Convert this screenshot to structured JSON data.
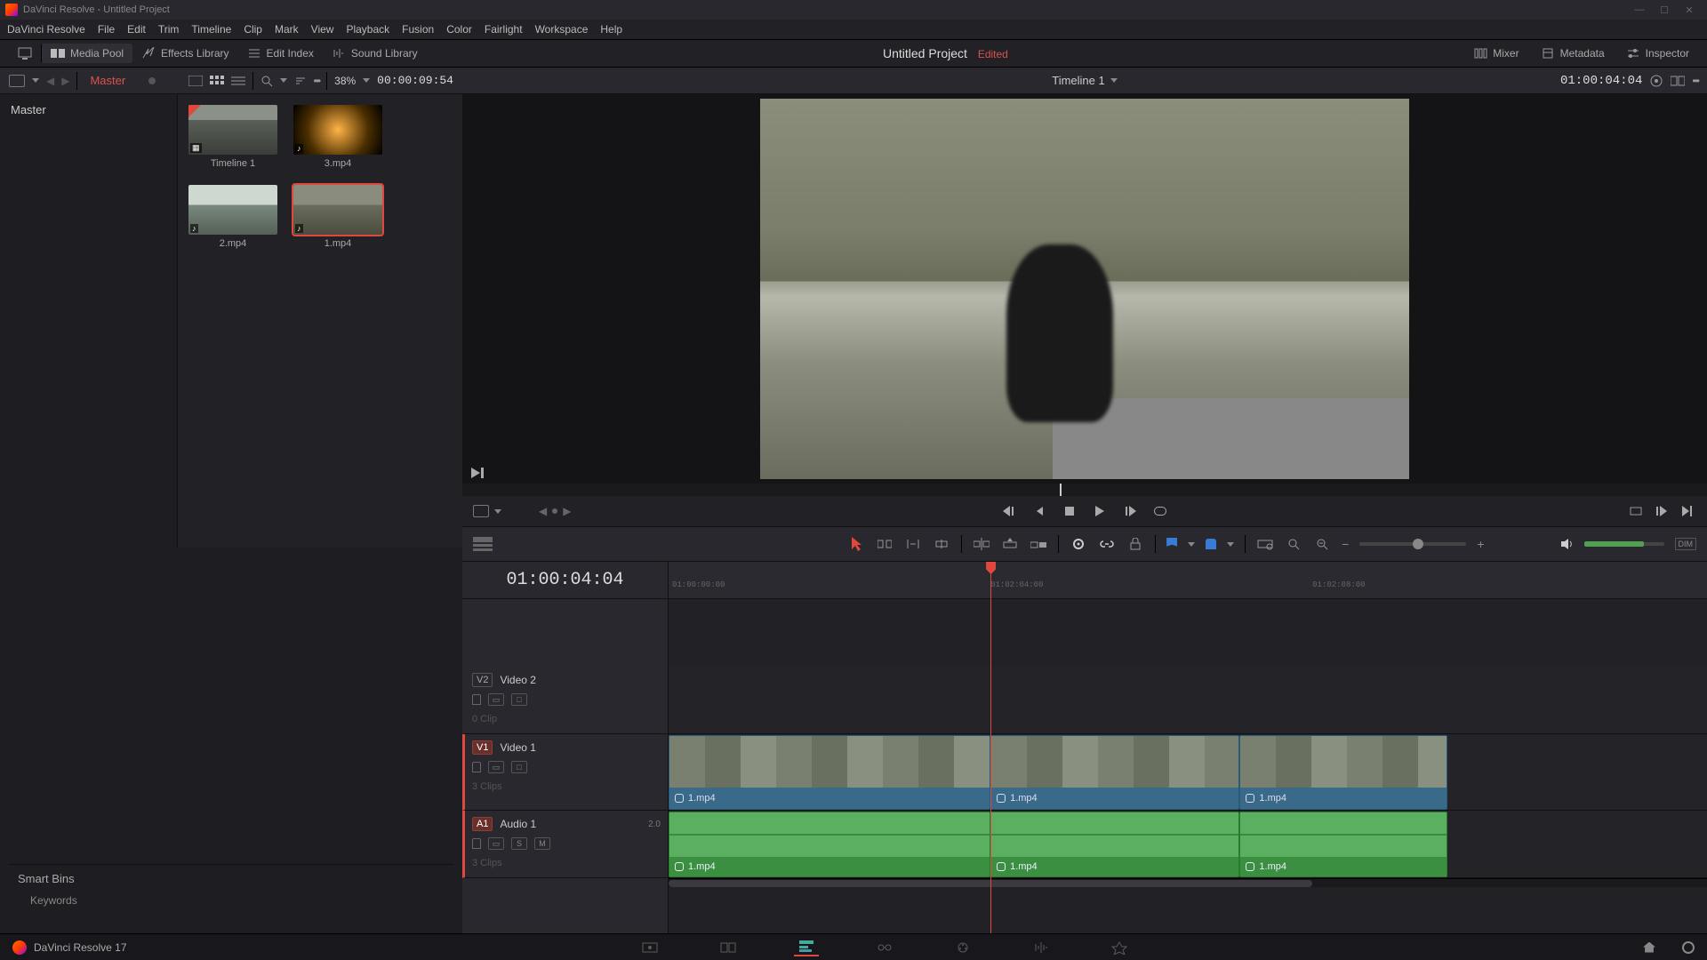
{
  "titlebar": {
    "text": "DaVinci Resolve - Untitled Project"
  },
  "menu": [
    "DaVinci Resolve",
    "File",
    "Edit",
    "Trim",
    "Timeline",
    "Clip",
    "Mark",
    "View",
    "Playback",
    "Fusion",
    "Color",
    "Fairlight",
    "Workspace",
    "Help"
  ],
  "panels": {
    "left": [
      {
        "id": "media-pool",
        "label": "Media Pool",
        "active": true
      },
      {
        "id": "effects-library",
        "label": "Effects Library"
      },
      {
        "id": "edit-index",
        "label": "Edit Index"
      },
      {
        "id": "sound-library",
        "label": "Sound Library"
      }
    ],
    "project": "Untitled Project",
    "status": "Edited",
    "right": [
      {
        "id": "mixer",
        "label": "Mixer"
      },
      {
        "id": "metadata",
        "label": "Metadata"
      },
      {
        "id": "inspector",
        "label": "Inspector"
      }
    ]
  },
  "pool": {
    "master": "Master",
    "zoom": "38%",
    "src_tc": "00:00:09:54",
    "timeline_name": "Timeline 1",
    "rec_tc": "01:00:04:04",
    "bin_root": "Master",
    "clips": [
      {
        "name": "Timeline 1",
        "thumb": "g-road",
        "is_timeline": true,
        "selected": false
      },
      {
        "name": "3.mp4",
        "thumb": "g-tunnel",
        "is_timeline": false,
        "selected": false
      },
      {
        "name": "2.mp4",
        "thumb": "g-lake",
        "is_timeline": false,
        "selected": false
      },
      {
        "name": "1.mp4",
        "thumb": "g-moto",
        "is_timeline": false,
        "selected": true
      }
    ],
    "smart_bins_title": "Smart Bins",
    "smart_bins": [
      "Keywords"
    ]
  },
  "timeline": {
    "tc": "01:00:04:04",
    "ruler": [
      "01:00:00:00",
      "01:02:04:00",
      "01:02:08:00"
    ],
    "playhead_pct": 31,
    "tracks": {
      "v2": {
        "id": "V2",
        "name": "Video 2",
        "clips_label": "0 Clip",
        "enabled": false
      },
      "v1": {
        "id": "V1",
        "name": "Video 1",
        "clips_label": "3 Clips",
        "enabled": true
      },
      "a1": {
        "id": "A1",
        "name": "Audio 1",
        "clips_label": "3 Clips",
        "enabled": true,
        "ch": "2.0",
        "solo": "S",
        "mute": "M"
      }
    },
    "video_clips": [
      {
        "name": "1.mp4",
        "width_pct": 31
      },
      {
        "name": "1.mp4",
        "width_pct": 24
      },
      {
        "name": "1.mp4",
        "width_pct": 20
      }
    ],
    "audio_clips": [
      {
        "name": "1.mp4",
        "width_pct": 31
      },
      {
        "name": "1.mp4",
        "width_pct": 24
      },
      {
        "name": "1.mp4",
        "width_pct": 20
      }
    ]
  },
  "toolbar": {
    "dim": "DIM"
  },
  "footer": {
    "app": "DaVinci Resolve 17"
  },
  "pages": [
    "media",
    "cut",
    "edit",
    "fusion",
    "color",
    "fairlight",
    "deliver"
  ],
  "active_page": "edit"
}
